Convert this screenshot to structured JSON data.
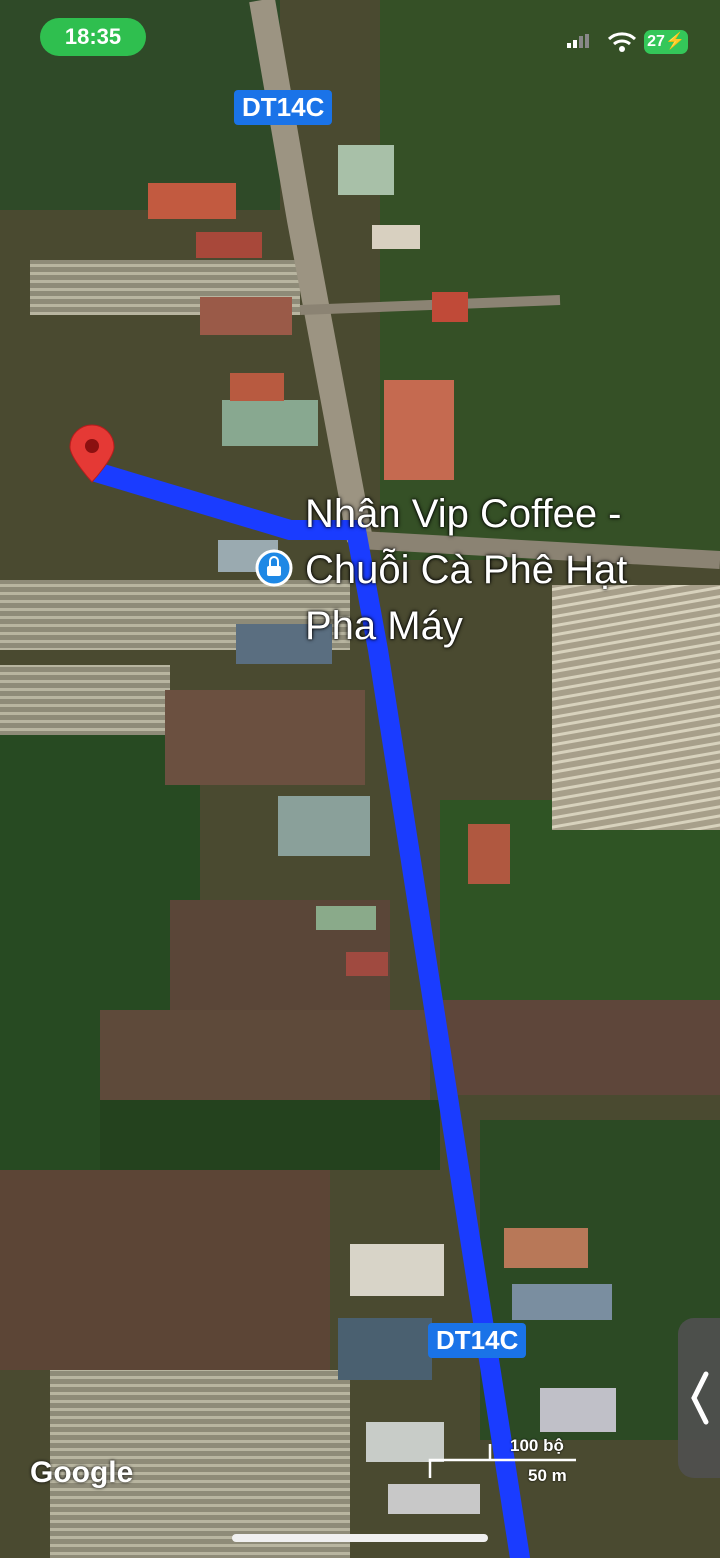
{
  "status_bar": {
    "time": "18:35",
    "battery": "27"
  },
  "map": {
    "road_labels": [
      "DT14C",
      "DT14C"
    ],
    "place": {
      "name": "Nhân Vip Coffee -\nChuỗi Cà Phê Hạt\nPha Máy",
      "icon": "lock-bag-icon"
    },
    "destination_icon": "location-pin-icon",
    "route_color": "#1a3cff",
    "pin_color": "#e53935",
    "attribution": "Google",
    "scale": {
      "imperial": "100 bộ",
      "metric": "50 m"
    }
  }
}
